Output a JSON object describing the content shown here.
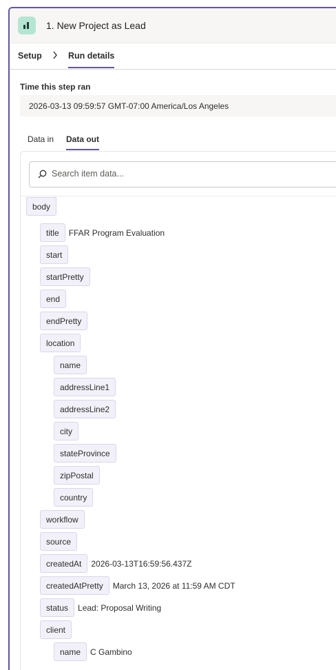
{
  "header": {
    "step_title": "1. New Project as Lead",
    "app_icon": "app-logo-icon"
  },
  "tabs_primary": [
    {
      "label": "Setup",
      "active": false
    },
    {
      "label": "Run details",
      "active": true
    }
  ],
  "run": {
    "time_label": "Time this step ran",
    "time_value": "2026-03-13 09:59:57 GMT-07:00 America/Los Angeles"
  },
  "tabs_data": [
    {
      "label": "Data in",
      "active": false
    },
    {
      "label": "Data out",
      "active": true
    }
  ],
  "search": {
    "placeholder": "Search item data..."
  },
  "tree": {
    "body": "body",
    "title": {
      "key": "title",
      "value": "FFAR Program Evaluation"
    },
    "start": "start",
    "startPretty": "startPretty",
    "end": "end",
    "endPretty": "endPretty",
    "location": "location",
    "loc_name": "name",
    "addressLine1": "addressLine1",
    "addressLine2": "addressLine2",
    "city": "city",
    "stateProvince": "stateProvince",
    "zipPostal": "zipPostal",
    "country": "country",
    "workflow": "workflow",
    "source": "source",
    "createdAt": {
      "key": "createdAt",
      "value": "2026-03-13T16:59:56.437Z"
    },
    "createdAtPretty": {
      "key": "createdAtPretty",
      "value": "March 13, 2026 at 11:59 AM CDT"
    },
    "status": {
      "key": "status",
      "value": "Lead: Proposal Writing"
    },
    "client": "client",
    "client_name": {
      "key": "name",
      "value": "C Gambino"
    }
  },
  "colors": {
    "accent": "#5f55a8",
    "key_bg": "#f2f1f9",
    "app_icon_bg": "#b4e6d3"
  }
}
